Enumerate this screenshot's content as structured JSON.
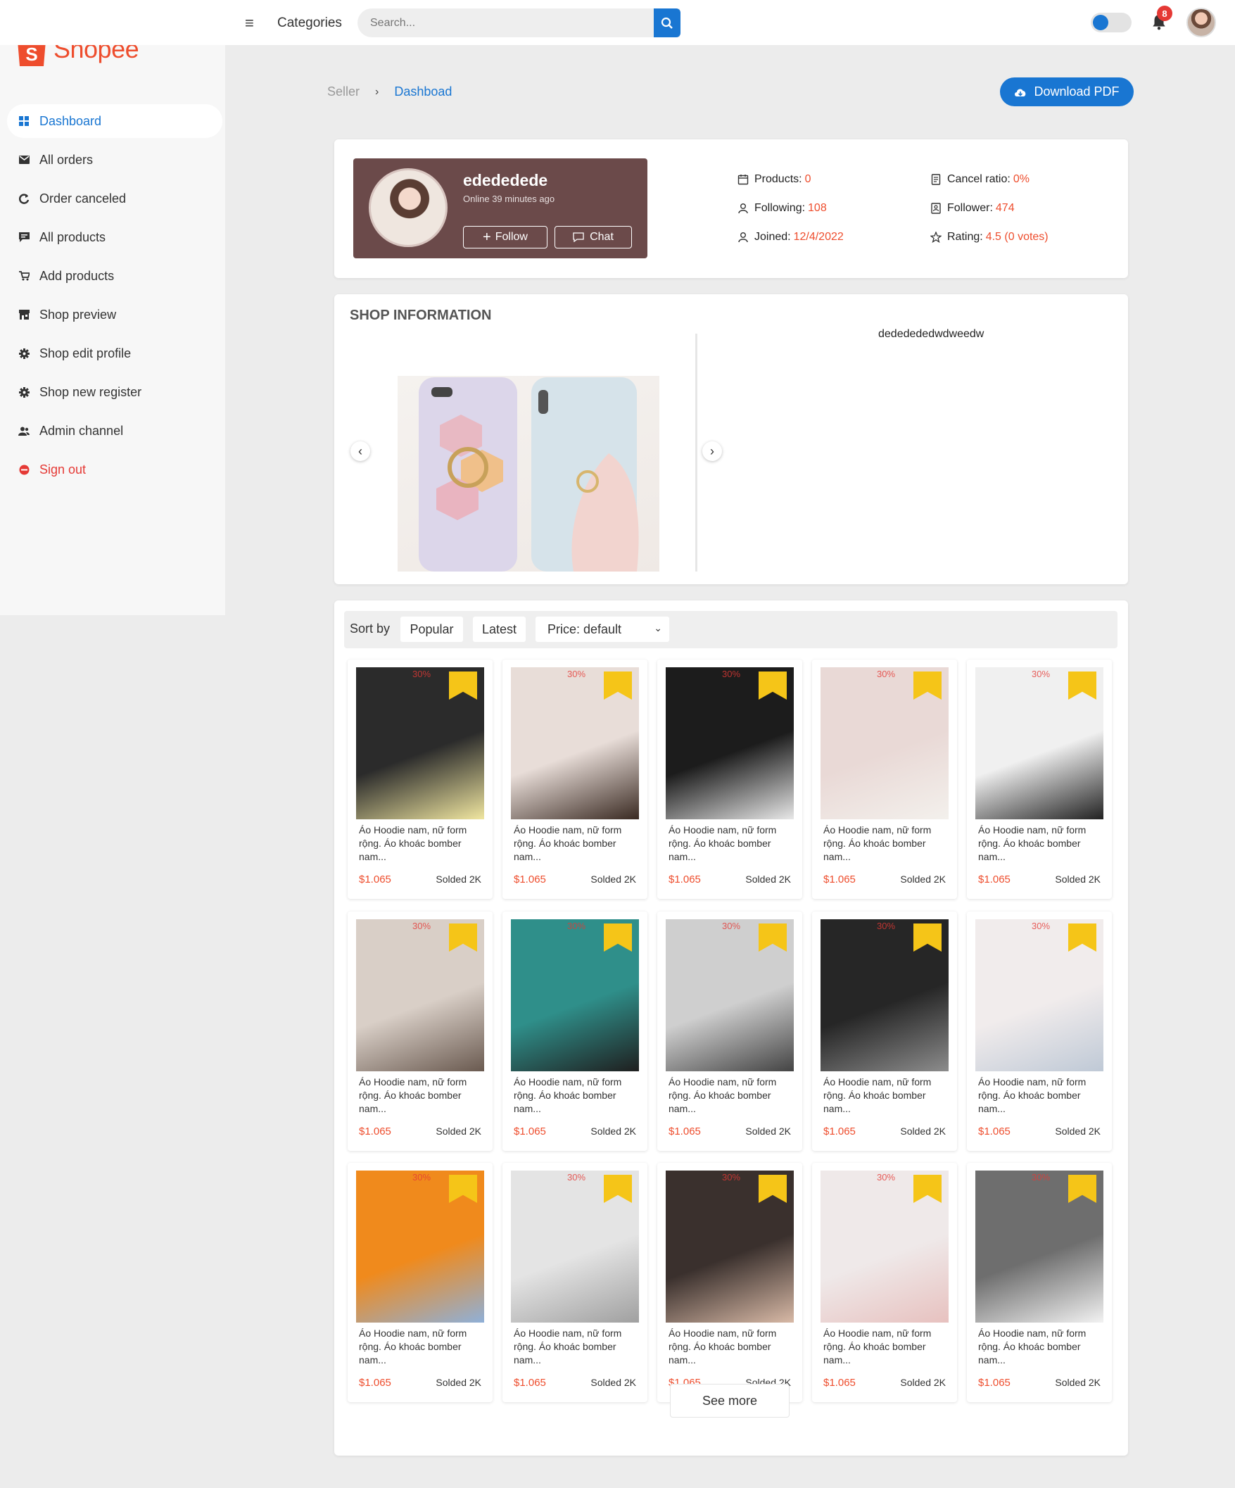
{
  "header": {
    "categories_label": "Categories",
    "search_placeholder": "Search...",
    "notification_count": "8",
    "accent_color": "#1976d2",
    "brand_color": "#ee4d2d"
  },
  "sidebar": {
    "logo_text": "Shopee",
    "items": [
      {
        "label": "Dashboard",
        "icon": "dashboard-icon",
        "active": true
      },
      {
        "label": "All orders",
        "icon": "mail-icon"
      },
      {
        "label": "Order canceled",
        "icon": "refresh-icon"
      },
      {
        "label": "All products",
        "icon": "chat-icon"
      },
      {
        "label": "Add products",
        "icon": "cart-icon"
      },
      {
        "label": "Shop preview",
        "icon": "store-icon"
      },
      {
        "label": "Shop edit profile",
        "icon": "gear-icon"
      },
      {
        "label": "Shop new register",
        "icon": "gear-icon"
      },
      {
        "label": "Admin channel",
        "icon": "users-icon"
      },
      {
        "label": "Sign out",
        "icon": "sign-out-icon"
      }
    ]
  },
  "breadcrumb": {
    "root": "Seller",
    "separator": "›",
    "current": "Dashboad"
  },
  "download_label": "Download PDF",
  "profile": {
    "shop_name": "edededede",
    "online_status": "Online 39 minutes ago",
    "follow_label": "Follow",
    "chat_label": "Chat",
    "stats": {
      "products_label": "Products:",
      "products_value": "0",
      "following_label": "Following:",
      "following_value": "108",
      "joined_label": "Joined:",
      "joined_value": "12/4/2022",
      "cancel_label": "Cancel ratio:",
      "cancel_value": "0%",
      "follower_label": "Follower:",
      "follower_value": "474",
      "rating_label": "Rating:",
      "rating_value": "4.5 (0 votes)"
    }
  },
  "shop_info": {
    "title": "SHOP INFORMATION",
    "description": "dededededwdweedw"
  },
  "sort": {
    "label": "Sort by",
    "popular": "Popular",
    "latest": "Latest",
    "price_select": "Price: default"
  },
  "products": {
    "title_text": "Áo Hoodie nam, nữ form rộng. Áo khoác bomber nam...",
    "price": "$1.065",
    "sold": "Solded 2K",
    "discount": "30%"
  },
  "see_more_label": "See more"
}
